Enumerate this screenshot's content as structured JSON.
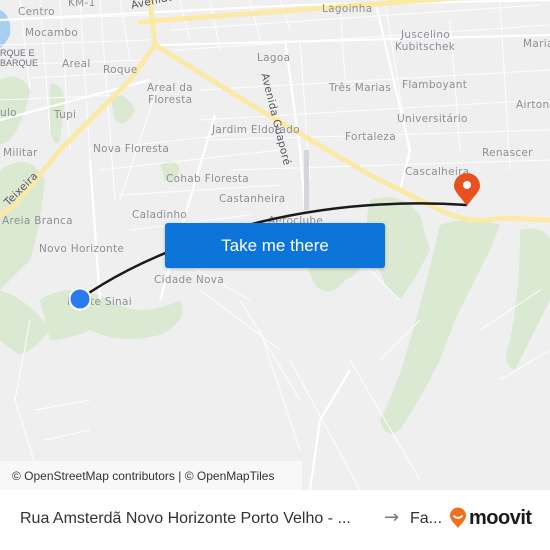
{
  "map": {
    "labels": {
      "km1": "KM-1",
      "centro": "Centro",
      "mocambo": "Mocambo",
      "parque1": "RQUE E",
      "parque2": "BARQUE",
      "areal": "Areal",
      "roque": "Roque",
      "areal_floresta1": "Areal da",
      "areal_floresta2": "Floresta",
      "lagoinha": "Lagoinha",
      "lagoa": "Lagoa",
      "juscelino1": "Juscelino",
      "juscelino2": "Kubitschek",
      "maria": "Maria",
      "tres_marias": "Três Marias",
      "flamboyant": "Flamboyant",
      "airton": "Airton",
      "universitario": "Universitário",
      "fortaleza": "Fortaleza",
      "renascer": "Renascer",
      "cascalheira": "Cascalheira",
      "ulo": "ulo",
      "tupi": "Tupi",
      "jardim_eldorado": "Jardim Eldorado",
      "militar": "Militar",
      "nova_floresta": "Nova Floresta",
      "cohab_floresta": "Cohab Floresta",
      "castanheira": "Castanheira",
      "caladinho": "Caladinho",
      "aeroclube": "Aeroclube",
      "areia_branca": "Areia Branca",
      "novo_horizonte": "Novo Horizonte",
      "cidade_nova": "Cidade Nova",
      "monte_sinai": "Monte Sinai"
    },
    "roads": {
      "amazonas": "Avenida Amazonas",
      "guapore": "Avenida Guaporé",
      "teixeira": "Teixeira"
    },
    "take_me_there": "Take me there",
    "attribution": "© OpenStreetMap contributors | © OpenMapTiles",
    "colors": {
      "origin": "#2b7bf0",
      "destination": "#e8501e",
      "route": "#1a1a1a",
      "button": "#0d74d9",
      "highway": "#fbe9a6",
      "park": "#dbe9d3"
    }
  },
  "footer": {
    "from": "Rua Amsterdã Novo Horizonte Porto Velho - ...",
    "arrow": "→",
    "to": "Fa...",
    "brand": "moovit",
    "brand_color": "#f46d1e"
  }
}
